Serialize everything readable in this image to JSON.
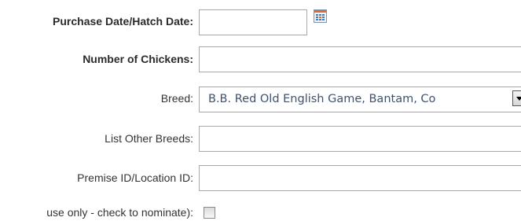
{
  "form": {
    "purchase_date": {
      "label": "Purchase Date/Hatch Date:",
      "value": ""
    },
    "chickens": {
      "label": "Number of Chickens:",
      "value": ""
    },
    "breed": {
      "label": "Breed:",
      "selected": "B.B. Red Old English Game, Bantam, Co"
    },
    "other_breeds": {
      "label": "List Other Breeds:",
      "value": ""
    },
    "premise": {
      "label": "Premise ID/Location ID:",
      "value": ""
    },
    "nominate": {
      "label": "use only - check to nominate):",
      "checked": false
    }
  },
  "icons": {
    "calendar": "calendar-icon",
    "dropdown": "chevron-down-icon"
  },
  "colors": {
    "border": "#a9a9a9",
    "select_text": "#3e5270",
    "label_text": "#333333"
  }
}
